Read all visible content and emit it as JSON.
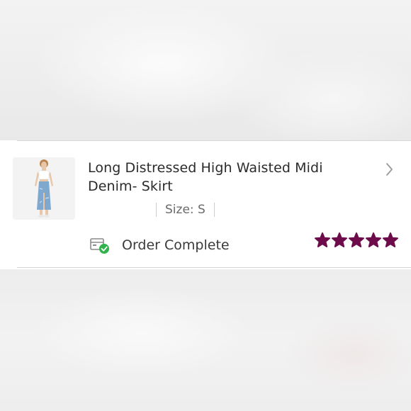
{
  "order_item": {
    "title": "Long Distressed High Waisted Midi Denim- Skirt",
    "size_label": "Size: S",
    "status_text": "Order Complete",
    "rating": 5,
    "rating_max": 5
  },
  "icons": {
    "thumbnail": "product-photo-denim-skirt",
    "chevron": "chevron-right-icon",
    "status": "package-check-icon",
    "rating": "star-icon"
  },
  "colors": {
    "star": "#6e0b4a",
    "check": "#2fb34a",
    "title": "#2b2b2b",
    "divider": "#d6d6d6"
  }
}
